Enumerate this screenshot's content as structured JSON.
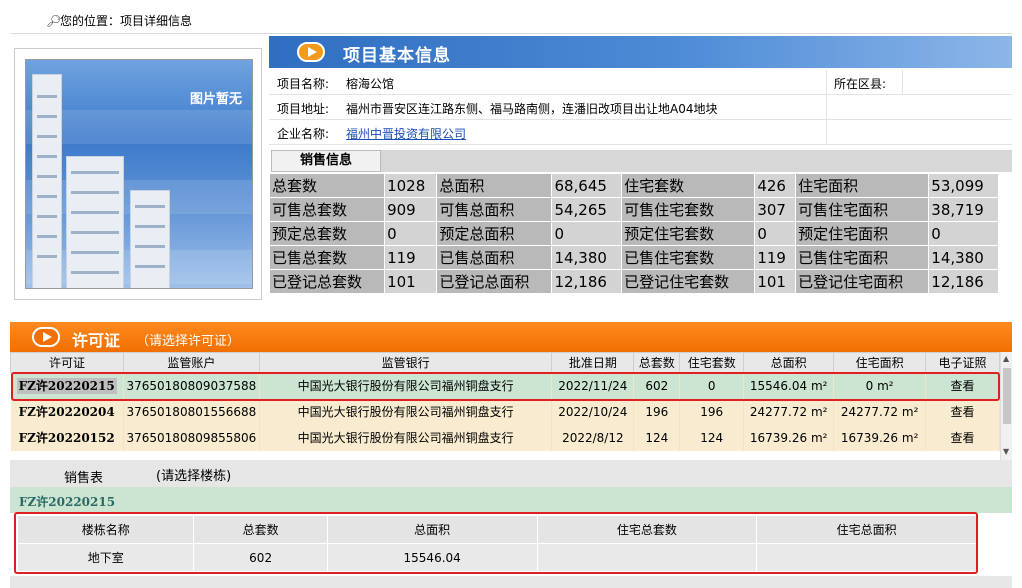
{
  "location": {
    "icon": "magnifier-icon",
    "text": "您的位置：项目详细信息"
  },
  "image_placeholder": "图片暂无",
  "section_title": "项目基本信息",
  "project": {
    "name_label": "项目名称:",
    "name": "榕海公馆",
    "district_label": "所在区县:",
    "address_label": "项目地址:",
    "address": "福州市晋安区连江路东侧、福马路南侧，连潘旧改项目出让地A04地块",
    "company_label": "企业名称:",
    "company": "福州中晋投资有限公司"
  },
  "sales_tab": "销售信息",
  "sales_info": [
    [
      "总套数",
      "1028",
      "总面积",
      "68,645",
      "住宅套数",
      "426",
      "住宅面积",
      "53,099"
    ],
    [
      "可售总套数",
      "909",
      "可售总面积",
      "54,265",
      "可售住宅套数",
      "307",
      "可售住宅面积",
      "38,719"
    ],
    [
      "预定总套数",
      "0",
      "预定总面积",
      "0",
      "预定住宅套数",
      "0",
      "预定住宅面积",
      "0"
    ],
    [
      "已售总套数",
      "119",
      "已售总面积",
      "14,380",
      "已售住宅套数",
      "119",
      "已售住宅面积",
      "14,380"
    ],
    [
      "已登记总套数",
      "101",
      "已登记总面积",
      "12,186",
      "已登记住宅套数",
      "101",
      "已登记住宅面积",
      "12,186"
    ]
  ],
  "permit": {
    "title": "许可证",
    "hint": "（请选择许可证）",
    "columns": [
      "许可证",
      "监管账户",
      "监管银行",
      "批准日期",
      "总套数",
      "住宅套数",
      "总面积",
      "住宅面积",
      "电子证照"
    ],
    "rows": [
      {
        "id": "FZ许20220215",
        "account": "37650180809037588",
        "bank": "中国光大银行股份有限公司福州铜盘支行",
        "date": "2022/11/24",
        "total": "602",
        "res": "0",
        "area": "15546.04 m²",
        "res_area": "0 m²",
        "view": "查看"
      },
      {
        "id": "FZ许20220204",
        "account": "37650180801556688",
        "bank": "中国光大银行股份有限公司福州铜盘支行",
        "date": "2022/10/24",
        "total": "196",
        "res": "196",
        "area": "24277.72 m²",
        "res_area": "24277.72 m²",
        "view": "查看"
      },
      {
        "id": "FZ许20220152",
        "account": "37650180809855806",
        "bank": "中国光大银行股份有限公司福州铜盘支行",
        "date": "2022/8/12",
        "total": "124",
        "res": "124",
        "area": "16739.26 m²",
        "res_area": "16739.26 m²",
        "view": "查看"
      }
    ]
  },
  "sales_table": {
    "tab": "销售表",
    "hint": "(请选择楼栋)",
    "selected_permit": "FZ许20220215",
    "columns": [
      "楼栋名称",
      "总套数",
      "总面积",
      "住宅总套数",
      "住宅总面积"
    ],
    "rows": [
      [
        "地下室",
        "602",
        "15546.04",
        "",
        ""
      ]
    ]
  },
  "colors": {
    "header_blue": "#2f6ec0",
    "permit_orange": "#f06f00",
    "highlight_red": "#e02020",
    "selected_green": "#cbe5d2"
  }
}
